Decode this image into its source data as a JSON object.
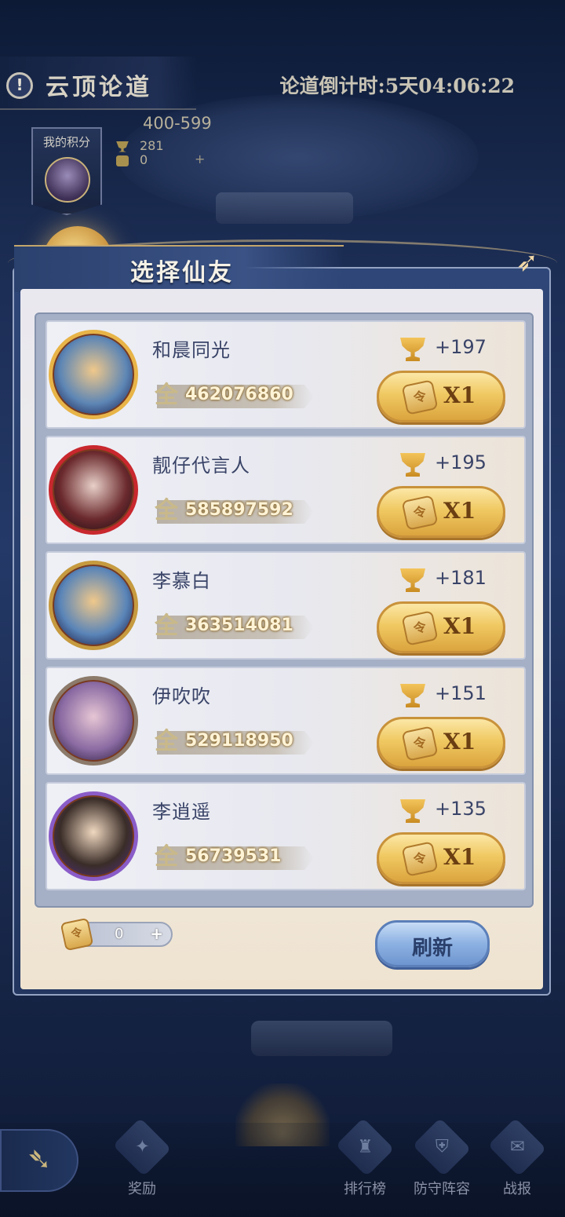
{
  "header": {
    "info_icon": "exclamation-icon",
    "title": "云顶论道",
    "countdown": "论道倒计时:5天04:06:22"
  },
  "my_score": {
    "label": "我的积分",
    "range": "400-599",
    "trophies": "281",
    "tickets": "0"
  },
  "modal": {
    "title": "选择仙友",
    "friends": [
      {
        "name": "和晨同光",
        "power": "462076860",
        "reward": "+197",
        "button": "X1"
      },
      {
        "name": "靓仔代言人",
        "power": "585897592",
        "reward": "+195",
        "button": "X1"
      },
      {
        "name": "李慕白",
        "power": "363514081",
        "reward": "+181",
        "button": "X1"
      },
      {
        "name": "伊吹吹",
        "power": "529118950",
        "reward": "+151",
        "button": "X1"
      },
      {
        "name": "李逍遥",
        "power": "56739531",
        "reward": "+135",
        "button": "X1"
      }
    ],
    "power_glyph": "全",
    "ticket_count": "0",
    "ticket_plus": "+",
    "refresh_label": "刷新"
  },
  "nav": {
    "rewards": "奖励",
    "leaderboard": "排行榜",
    "defense_lineup": "防守阵容",
    "battle_report": "战报"
  }
}
